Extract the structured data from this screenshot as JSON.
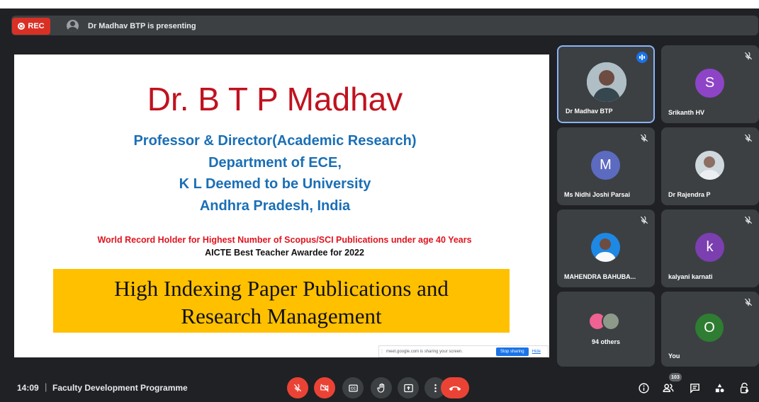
{
  "recording": {
    "label": "REC"
  },
  "presenter": {
    "text": "Dr Madhav BTP is presenting"
  },
  "slide": {
    "title": "Dr. B T P Madhav",
    "subtitle_lines": [
      "Professor & Director(Academic Research)",
      "Department of ECE,",
      "K L Deemed to be University",
      "Andhra Pradesh, India"
    ],
    "record_line": "World Record Holder for Highest Number of Scopus/SCI Publications under age 40 Years",
    "award_line": "AICTE Best Teacher Awardee for 2022",
    "banner_lines": [
      "High Indexing Paper Publications and",
      "Research Management"
    ],
    "colors": {
      "title": "#c0121f",
      "subtitle": "#1a6fb6",
      "banner": "#ffc000"
    }
  },
  "share_notice": {
    "message": "meet.google.com is sharing your screen.",
    "stop_label": "Stop sharing",
    "hide_label": "Hide"
  },
  "participants": [
    {
      "name": "Dr Madhav BTP",
      "avatar": "photo",
      "speaking": true
    },
    {
      "name": "Srikanth HV",
      "avatar": "S",
      "color": "#8e44c7",
      "muted": true
    },
    {
      "name": "Ms Nidhi Joshi Parsai",
      "avatar": "M",
      "color": "#5c6bc0",
      "muted": true
    },
    {
      "name": "Dr Rajendra P",
      "avatar": "photo",
      "muted": true
    },
    {
      "name": "MAHENDRA BAHUBA...",
      "avatar": "photo",
      "muted": true
    },
    {
      "name": "kalyani karnati",
      "avatar": "k",
      "color": "#7b3fb0",
      "muted": true
    },
    {
      "name": "94 others",
      "avatar": "group"
    },
    {
      "name": "You",
      "avatar": "O",
      "color": "#2e7d32",
      "muted": true
    }
  ],
  "bottom_bar": {
    "time": "14:09",
    "separator": "|",
    "meeting_title": "Faculty Development Programme",
    "participant_count": "103"
  }
}
